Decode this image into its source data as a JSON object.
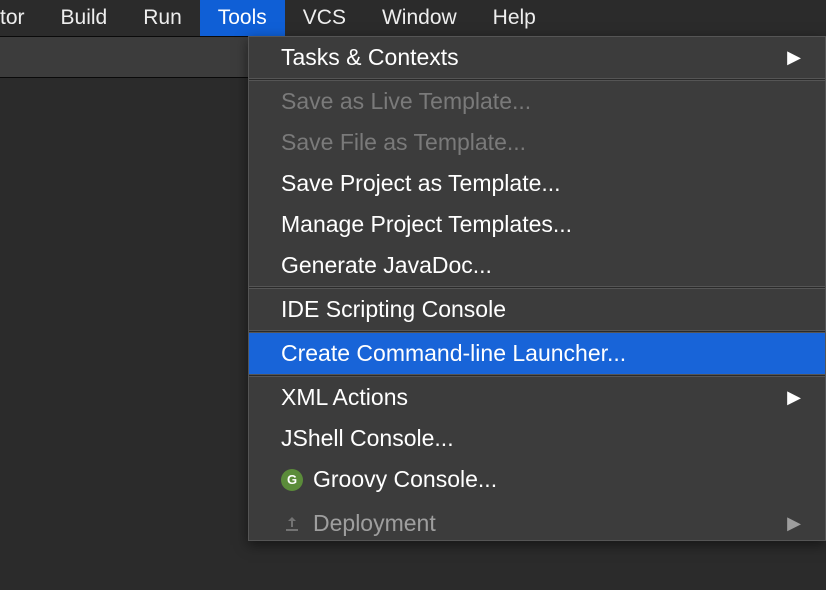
{
  "menubar": {
    "partial": "tor",
    "items": [
      "Build",
      "Run",
      "Tools",
      "VCS",
      "Window",
      "Help"
    ],
    "selected_index": 2
  },
  "dropdown": {
    "groups": [
      [
        {
          "label": "Tasks & Contexts",
          "submenu": true,
          "disabled": false
        }
      ],
      [
        {
          "label": "Save as Live Template...",
          "disabled": true
        },
        {
          "label": "Save File as Template...",
          "disabled": true
        },
        {
          "label": "Save Project as Template...",
          "disabled": false
        },
        {
          "label": "Manage Project Templates...",
          "disabled": false
        },
        {
          "label": "Generate JavaDoc...",
          "disabled": false
        }
      ],
      [
        {
          "label": "IDE Scripting Console",
          "disabled": false
        }
      ],
      [
        {
          "label": "Create Command-line Launcher...",
          "disabled": false,
          "highlighted": true
        }
      ],
      [
        {
          "label": "XML Actions",
          "submenu": true,
          "disabled": false
        },
        {
          "label": "JShell Console...",
          "disabled": false
        },
        {
          "label": "Groovy Console...",
          "disabled": false,
          "icon": "groovy"
        },
        {
          "label": "Deployment",
          "disabled": false,
          "icon": "deploy",
          "submenu": true,
          "cutoff": true
        }
      ]
    ]
  },
  "icons": {
    "groovy_letter": "G"
  }
}
